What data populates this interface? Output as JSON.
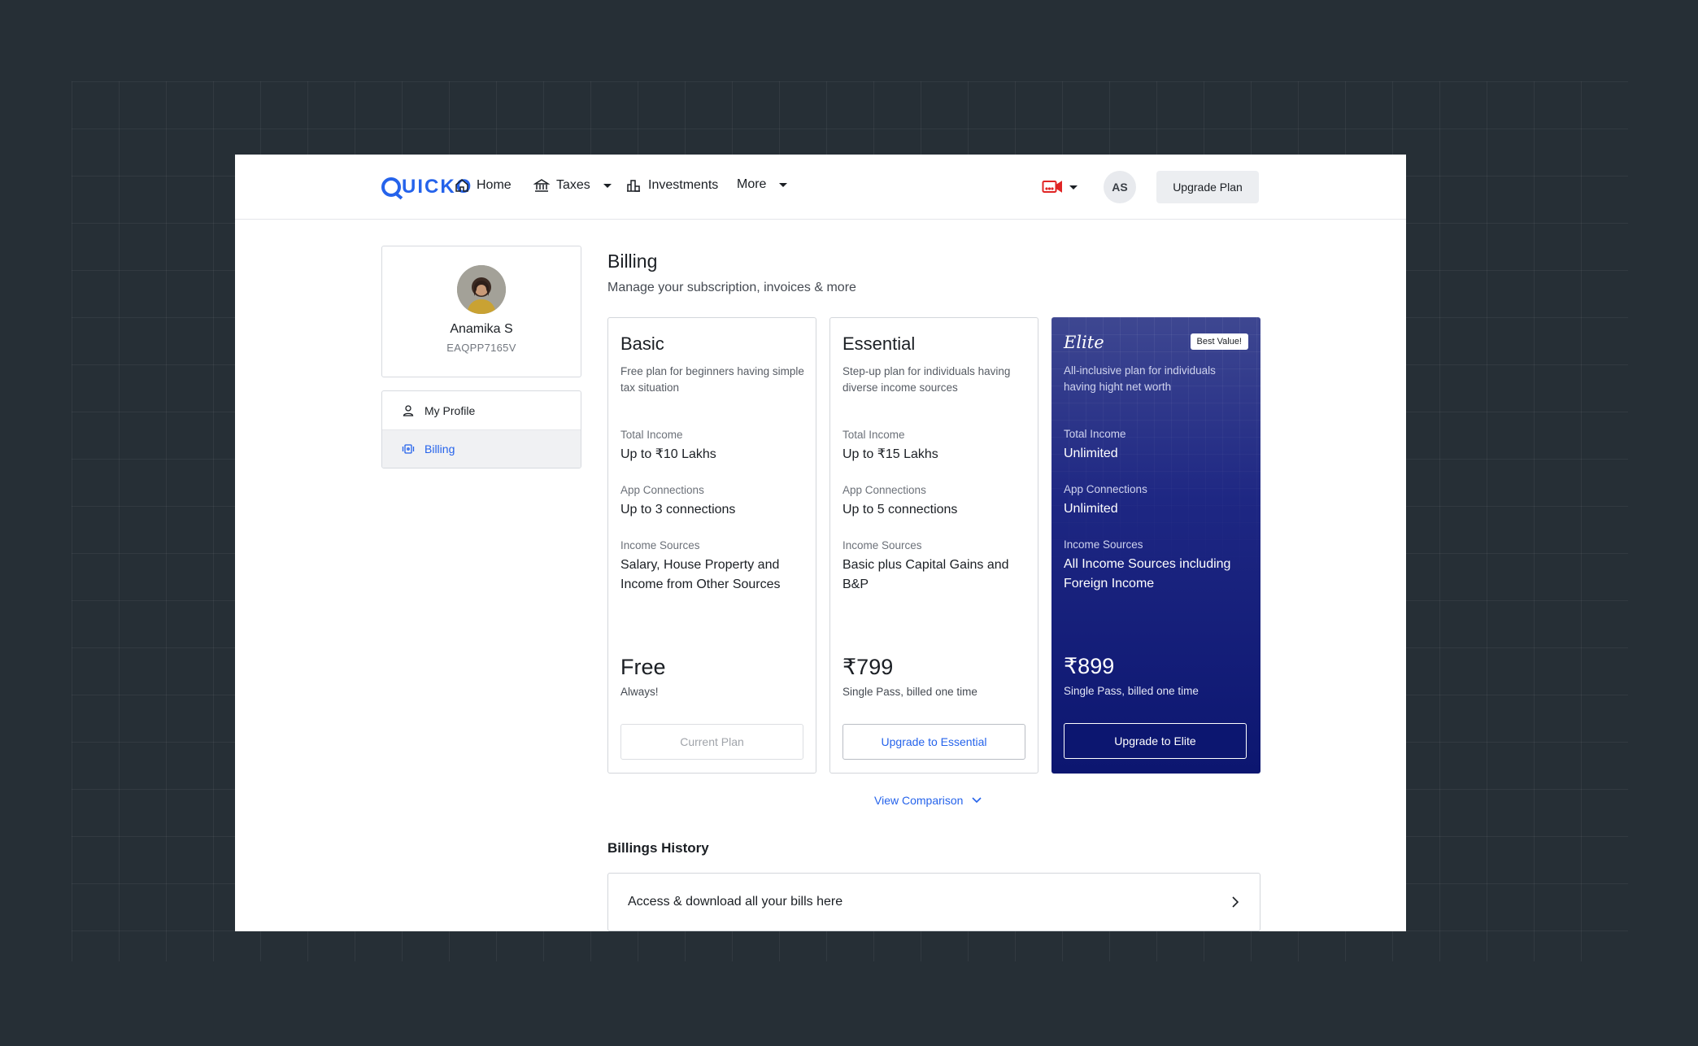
{
  "brand": {
    "logo_text": "UICKO",
    "accent": "#2563eb"
  },
  "nav": {
    "home": "Home",
    "taxes": "Taxes",
    "investments": "Investments",
    "more": "More"
  },
  "header": {
    "avatar_initials": "AS",
    "upgrade_label": "Upgrade Plan",
    "video_icon": "video-camera-icon"
  },
  "profile": {
    "name": "Anamika S",
    "id": "EAQPP7165V"
  },
  "sidebar": {
    "items": [
      {
        "label": "My Profile",
        "icon": "user-icon"
      },
      {
        "label": "Billing",
        "icon": "billing-icon"
      }
    ]
  },
  "billing": {
    "title": "Billing",
    "subtitle": "Manage your subscription, invoices & more"
  },
  "plans": [
    {
      "name": "Basic",
      "description": "Free plan for beginners having simple tax situation",
      "total_income_label": "Total Income",
      "total_income": "Up to ₹10 Lakhs",
      "app_connections_label": "App Connections",
      "app_connections": "Up to 3 connections",
      "income_sources_label": "Income Sources",
      "income_sources": "Salary, House Property and Income from Other Sources",
      "price": "Free",
      "price_note": "Always!",
      "button": "Current Plan"
    },
    {
      "name": "Essential",
      "description": "Step-up plan for individuals having diverse income sources",
      "total_income_label": "Total Income",
      "total_income": "Up to ₹15 Lakhs",
      "app_connections_label": "App Connections",
      "app_connections": "Up to 5 connections",
      "income_sources_label": "Income Sources",
      "income_sources": "Basic plus Capital Gains and B&P",
      "price": "₹799",
      "price_note": "Single Pass, billed one time",
      "button": "Upgrade to Essential"
    },
    {
      "name": "Elite",
      "badge": "Best Value!",
      "description": "All-inclusive plan for individuals having hight net worth",
      "total_income_label": "Total Income",
      "total_income": "Unlimited",
      "app_connections_label": "App Connections",
      "app_connections": "Unlimited",
      "income_sources_label": "Income Sources",
      "income_sources": "All Income Sources including Foreign Income",
      "price": "₹899",
      "price_note": "Single Pass, billed one time",
      "button": "Upgrade to Elite",
      "color": "#1e2783"
    }
  ],
  "view_comparison": "View Comparison",
  "history": {
    "title": "Billings History",
    "row": "Access & download all your bills here"
  }
}
